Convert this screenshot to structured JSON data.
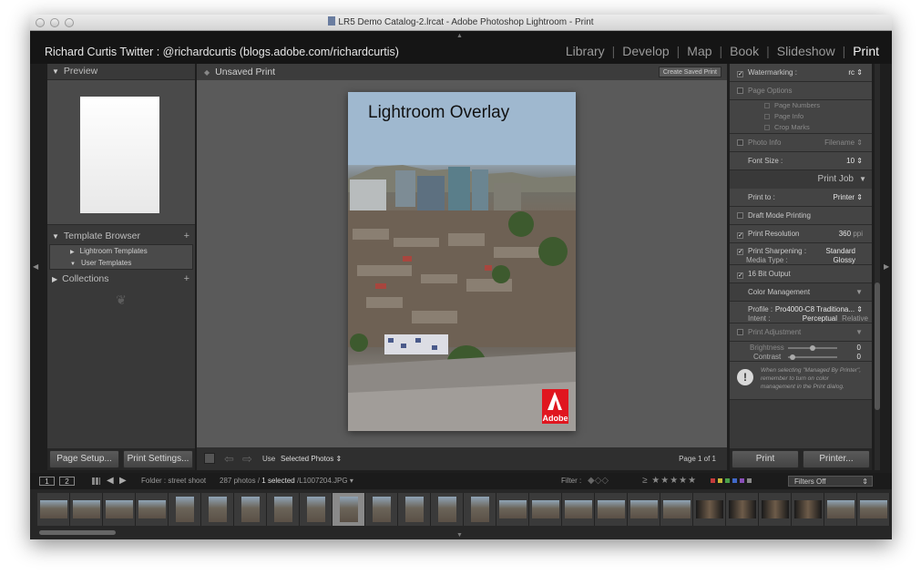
{
  "window": {
    "title": "LR5 Demo Catalog-2.lrcat - Adobe Photoshop Lightroom - Print"
  },
  "identity_plate": "Richard Curtis Twitter : @richardcurtis (blogs.adobe.com/richardcurtis)",
  "modules": [
    {
      "label": "Library",
      "active": false
    },
    {
      "label": "Develop",
      "active": false
    },
    {
      "label": "Map",
      "active": false
    },
    {
      "label": "Book",
      "active": false
    },
    {
      "label": "Slideshow",
      "active": false
    },
    {
      "label": "Print",
      "active": true
    }
  ],
  "left_panel": {
    "preview_label": "Preview",
    "template_browser_label": "Template Browser",
    "templates": [
      "Lightroom Templates",
      "User Templates"
    ],
    "collections_label": "Collections",
    "page_setup_label": "Page Setup...",
    "print_settings_label": "Print Settings..."
  },
  "center": {
    "header_title": "Unsaved Print",
    "create_saved_print_label": "Create Saved Print",
    "overlay_title": "Lightroom Overlay",
    "adobe_logo_text": "Adobe",
    "use_label": "Use",
    "use_value": "Selected Photos",
    "page_indicator": "Page 1 of 1"
  },
  "right_panel": {
    "watermarking_label": "Watermarking :",
    "watermarking_value": "rc",
    "page_options_label": "Page Options",
    "page_options": [
      "Page Numbers",
      "Page Info",
      "Crop Marks"
    ],
    "photo_info_label": "Photo Info",
    "photo_info_value": "Filename",
    "font_size_label": "Font Size :",
    "font_size_value": "10",
    "print_job_label": "Print Job",
    "print_to_label": "Print to :",
    "print_to_value": "Printer",
    "draft_mode_label": "Draft Mode Printing",
    "print_resolution_label": "Print Resolution",
    "print_resolution_value": "360",
    "print_resolution_unit": "ppi",
    "print_sharpening_label": "Print Sharpening :",
    "print_sharpening_value": "Standard",
    "media_type_label": "Media Type :",
    "media_type_value": "Glossy",
    "bit_output_label": "16 Bit Output",
    "color_management_label": "Color Management",
    "profile_label": "Profile :",
    "profile_value": "Pro4000-C8 Traditiona...",
    "intent_label": "Intent :",
    "intent_perceptual": "Perceptual",
    "intent_relative": "Relative",
    "print_adjustment_label": "Print Adjustment",
    "brightness_label": "Brightness",
    "brightness_value": "0",
    "contrast_label": "Contrast",
    "contrast_value": "0",
    "note_text": "When selecting \"Managed By Printer\", remember to turn on color management in the Print dialog.",
    "print_button_label": "Print",
    "printer_button_label": "Printer..."
  },
  "filmstrip": {
    "screen1": "1",
    "screen2": "2",
    "folder_label": "Folder : street shoot",
    "photo_count": "287 photos /",
    "selected_count": "1 selected",
    "selected_file": "/L1007204.JPG",
    "filter_label": "Filter :",
    "stars": "≥ ★★★★★",
    "filters_value": "Filters Off",
    "label_colors": [
      "#c43b3b",
      "#c9b83a",
      "#4aa04a",
      "#4169c8",
      "#8a4fb8",
      "#888888"
    ]
  }
}
